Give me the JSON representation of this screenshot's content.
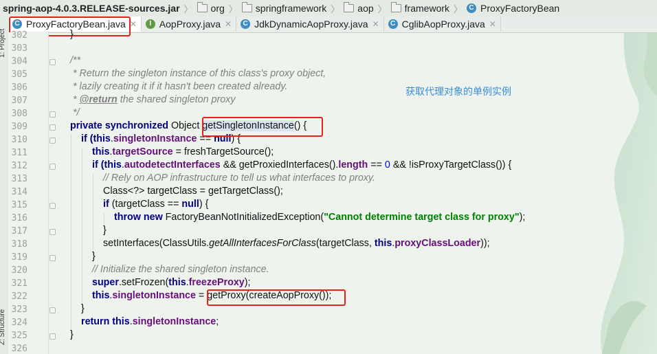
{
  "breadcrumb": [
    "spring-aop-4.0.3.RELEASE-sources.jar",
    "org",
    "springframework",
    "aop",
    "framework",
    "ProxyFactoryBean"
  ],
  "tabs": [
    {
      "label": "ProxyFactoryBean.java",
      "kind": "class",
      "active": true
    },
    {
      "label": "AopProxy.java",
      "kind": "interface",
      "active": false
    },
    {
      "label": "JdkDynamicAopProxy.java",
      "kind": "class",
      "active": false
    },
    {
      "label": "CglibAopProxy.java",
      "kind": "class",
      "active": false
    }
  ],
  "side_panel": {
    "top_label": "1: Project",
    "bottom_label": "Z: Structure"
  },
  "annotation": "获取代理对象的单例实例",
  "code": {
    "line_numbers": [
      "302",
      "303",
      "304",
      "305",
      "306",
      "307",
      "308",
      "309",
      "310",
      "311",
      "312",
      "313",
      "314",
      "315",
      "316",
      "317",
      "318",
      "319",
      "320",
      "321",
      "322",
      "323",
      "324",
      "325",
      "326"
    ],
    "l302": "}",
    "l304": "/**",
    "l305": "* Return the singleton instance of this class's proxy object,",
    "l306": "* lazily creating it if it hasn't been created already.",
    "l307_star": "* ",
    "l307_tag": "@return",
    "l307_rest": " the shared singleton proxy",
    "l308": "*/",
    "l309_kw": "private synchronized",
    "l309_type": " Object ",
    "l309_method": "getSingletonInstance",
    "l309_rest": "() {",
    "l310_a": "if (",
    "l310_this": "this",
    "l310_dot": ".",
    "l310_fld": "singletonInstance",
    "l310_op": " == ",
    "l310_null": "null",
    "l310_end": ") {",
    "l311_this": "this",
    "l311_dot": ".",
    "l311_fld": "targetSource",
    "l311_rest": " = freshTargetSource();",
    "l312_if": "if (",
    "l312_this": "this",
    "l312_dot": ".",
    "l312_fld": "autodetectInterfaces",
    "l312_mid": " && getProxiedInterfaces().",
    "l312_len": "length",
    "l312_eq": " == ",
    "l312_zero": "0",
    "l312_rest": " && !isProxyTargetClass()) {",
    "l313": "// Rely on AOP infrastructure to tell us what interfaces to proxy.",
    "l314": "Class<?> targetClass = getTargetClass();",
    "l315_if": "if",
    "l315_mid": " (targetClass == ",
    "l315_null": "null",
    "l315_end": ") {",
    "l316_kw": "throw new",
    "l316_mid": " FactoryBeanNotInitializedException(",
    "l316_str": "\"Cannot determine target class for proxy\"",
    "l316_end": ");",
    "l317": "}",
    "l318_a": "setInterfaces(ClassUtils.",
    "l318_static": "getAllInterfacesForClass",
    "l318_b": "(targetClass, ",
    "l318_this": "this",
    "l318_dot": ".",
    "l318_fld": "proxyClassLoader",
    "l318_end": "));",
    "l319": "}",
    "l320": "// Initialize the shared singleton instance.",
    "l321_kw": "super",
    "l321_mid": ".setFrozen(",
    "l321_this": "this",
    "l321_dot": ".",
    "l321_fld": "freezeProxy",
    "l321_end": ");",
    "l322_this": "this",
    "l322_dot": ".",
    "l322_fld": "singletonInstance",
    "l322_eq": " = ",
    "l322_call": "getProxy(createAopProxy());",
    "l323": "}",
    "l324_kw": "return",
    "l324_sp": " ",
    "l324_this": "this",
    "l324_dot": ".",
    "l324_fld": "singletonInstance",
    "l324_end": ";",
    "l325": "}"
  },
  "colors": {
    "highlight_box": "#e0241b",
    "annotation": "#3a8ed8",
    "keyword": "#000080",
    "field": "#660e7a",
    "string": "#008000",
    "comment": "#808080"
  }
}
